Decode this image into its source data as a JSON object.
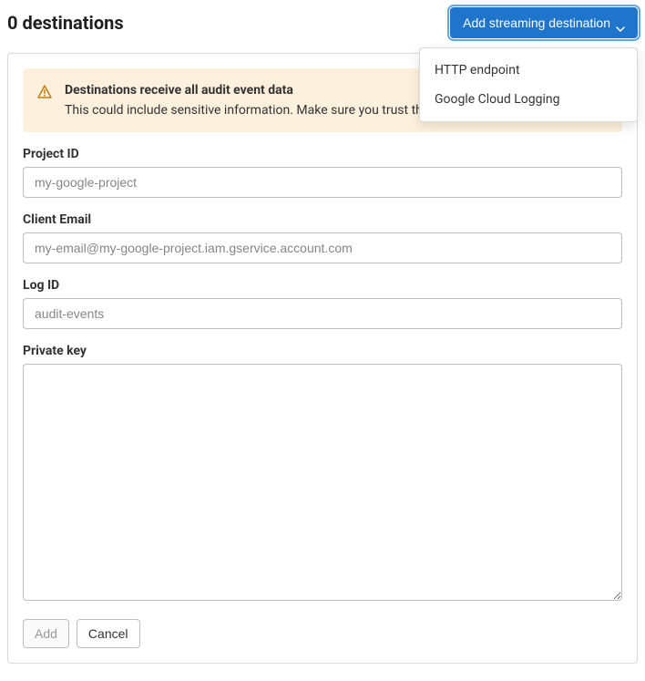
{
  "header": {
    "title": "0 destinations",
    "add_button_label": "Add streaming destination"
  },
  "dropdown": {
    "items": [
      {
        "label": "HTTP endpoint"
      },
      {
        "label": "Google Cloud Logging"
      }
    ]
  },
  "alert": {
    "title": "Destinations receive all audit event data",
    "description": "This could include sensitive information. Make sure you trust the destination endpoint."
  },
  "form": {
    "project_id": {
      "label": "Project ID",
      "placeholder": "my-google-project",
      "value": ""
    },
    "client_email": {
      "label": "Client Email",
      "placeholder": "my-email@my-google-project.iam.gservice.account.com",
      "value": ""
    },
    "log_id": {
      "label": "Log ID",
      "placeholder": "audit-events",
      "value": ""
    },
    "private_key": {
      "label": "Private key",
      "value": ""
    },
    "add_button": "Add",
    "cancel_button": "Cancel"
  }
}
